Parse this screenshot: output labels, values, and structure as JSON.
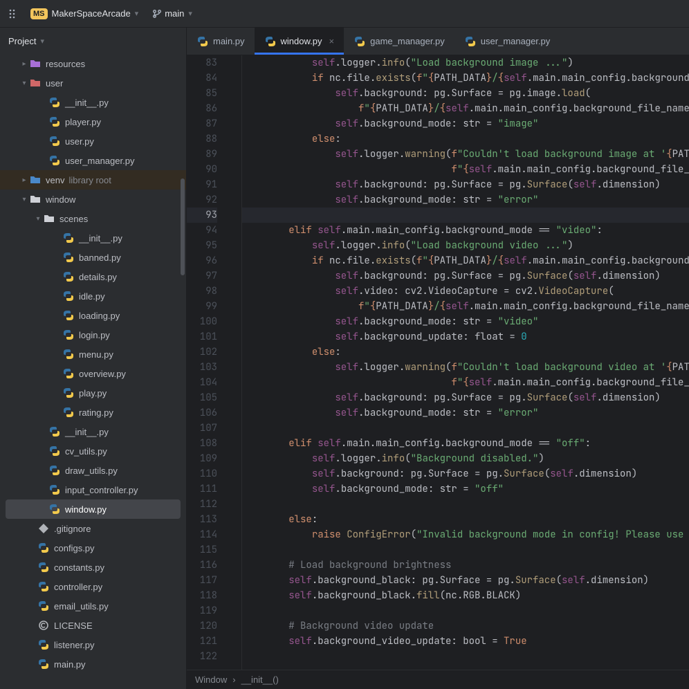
{
  "project": {
    "badge": "MS",
    "name": "MakerSpaceArcade",
    "branch": "main"
  },
  "sidebar": {
    "title": "Project",
    "items": [
      {
        "indent": 28,
        "arrow": "closed",
        "icon": "folder-purple",
        "label": "resources"
      },
      {
        "indent": 28,
        "arrow": "open",
        "icon": "folder-red",
        "label": "user"
      },
      {
        "indent": 56,
        "arrow": "",
        "icon": "py",
        "label": "__init__.py"
      },
      {
        "indent": 56,
        "arrow": "",
        "icon": "py",
        "label": "player.py"
      },
      {
        "indent": 56,
        "arrow": "",
        "icon": "py",
        "label": "user.py"
      },
      {
        "indent": 56,
        "arrow": "",
        "icon": "py",
        "label": "user_manager.py"
      },
      {
        "indent": 28,
        "arrow": "closed",
        "icon": "folder-lib",
        "label": "venv",
        "trailing": "library root",
        "variant": "venv"
      },
      {
        "indent": 28,
        "arrow": "open",
        "icon": "folder",
        "label": "window"
      },
      {
        "indent": 48,
        "arrow": "open",
        "icon": "folder",
        "label": "scenes"
      },
      {
        "indent": 76,
        "arrow": "",
        "icon": "py",
        "label": "__init__.py"
      },
      {
        "indent": 76,
        "arrow": "",
        "icon": "py",
        "label": "banned.py"
      },
      {
        "indent": 76,
        "arrow": "",
        "icon": "py",
        "label": "details.py"
      },
      {
        "indent": 76,
        "arrow": "",
        "icon": "py",
        "label": "idle.py"
      },
      {
        "indent": 76,
        "arrow": "",
        "icon": "py",
        "label": "loading.py"
      },
      {
        "indent": 76,
        "arrow": "",
        "icon": "py",
        "label": "login.py"
      },
      {
        "indent": 76,
        "arrow": "",
        "icon": "py",
        "label": "menu.py"
      },
      {
        "indent": 76,
        "arrow": "",
        "icon": "py",
        "label": "overview.py"
      },
      {
        "indent": 76,
        "arrow": "",
        "icon": "py",
        "label": "play.py"
      },
      {
        "indent": 76,
        "arrow": "",
        "icon": "py",
        "label": "rating.py"
      },
      {
        "indent": 56,
        "arrow": "",
        "icon": "py",
        "label": "__init__.py"
      },
      {
        "indent": 56,
        "arrow": "",
        "icon": "py",
        "label": "cv_utils.py"
      },
      {
        "indent": 56,
        "arrow": "",
        "icon": "py",
        "label": "draw_utils.py"
      },
      {
        "indent": 56,
        "arrow": "",
        "icon": "py",
        "label": "input_controller.py"
      },
      {
        "indent": 56,
        "arrow": "",
        "icon": "py",
        "label": "window.py",
        "selected": true
      },
      {
        "indent": 40,
        "arrow": "",
        "icon": "gitignore",
        "label": ".gitignore"
      },
      {
        "indent": 40,
        "arrow": "",
        "icon": "py",
        "label": "configs.py"
      },
      {
        "indent": 40,
        "arrow": "",
        "icon": "py",
        "label": "constants.py"
      },
      {
        "indent": 40,
        "arrow": "",
        "icon": "py",
        "label": "controller.py"
      },
      {
        "indent": 40,
        "arrow": "",
        "icon": "py",
        "label": "email_utils.py"
      },
      {
        "indent": 40,
        "arrow": "",
        "icon": "license",
        "label": "LICENSE"
      },
      {
        "indent": 40,
        "arrow": "",
        "icon": "py",
        "label": "listener.py"
      },
      {
        "indent": 40,
        "arrow": "",
        "icon": "py",
        "label": "main.py"
      }
    ]
  },
  "tabs": [
    {
      "label": "main.py",
      "active": false
    },
    {
      "label": "window.py",
      "active": true
    },
    {
      "label": "game_manager.py",
      "active": false
    },
    {
      "label": "user_manager.py",
      "active": false
    }
  ],
  "gutter": {
    "start": 83,
    "end": 122,
    "current": 93
  },
  "code_lines": [
    "            <span class='slf'>self</span>.logger.<span class='fn'>info</span>(<span class='str'>\"Load background image ...\"</span>)",
    "            <span class='kw'>if </span>nc.file.<span class='fn'>exists</span>(<span class='kw'>f</span><span class='str'>\"</span><span class='fstrbrace'>{</span>PATH_DATA<span class='fstrbrace'>}</span><span class='str'>/</span><span class='fstrbrace'>{</span><span class='slf'>self</span>.main.main_config.background_fil",
    "                <span class='slf'>self</span>.background: pg.Surface = pg.image.<span class='fn'>load</span>(",
    "                    <span class='kw'>f</span><span class='str'>\"</span><span class='fstrbrace'>{</span>PATH_DATA<span class='fstrbrace'>}</span><span class='str'>/</span><span class='fstrbrace'>{</span><span class='slf'>self</span>.main.main_config.background_file_name<span class='fstrbrace'>}</span><span class='str'>\"</span>)",
    "                <span class='slf'>self</span>.background_mode: <span class='typ'>str</span> = <span class='str'>\"image\"</span>",
    "            <span class='kw'>else</span>:",
    "                <span class='slf'>self</span>.logger.<span class='fn'>warning</span>(<span class='kw'>f</span><span class='str'>\"Couldn't load background image at '</span><span class='fstrbrace'>{</span>PATH_DA",
    "                                    <span class='kw'>f</span><span class='str'>\"</span><span class='fstrbrace'>{</span><span class='slf'>self</span>.main.main_config.background_file_name",
    "                <span class='slf'>self</span>.background: pg.Surface = pg.<span class='fn'>Surface</span>(<span class='slf'>self</span>.dimension)",
    "                <span class='slf'>self</span>.background_mode: <span class='typ'>str</span> = <span class='str'>\"error\"</span>",
    "",
    "        <span class='kw'>elif </span><span class='slf'>self</span>.main.main_config.background_mode == <span class='str'>\"video\"</span>:",
    "            <span class='slf'>self</span>.logger.<span class='fn'>info</span>(<span class='str'>\"Load background video ...\"</span>)",
    "            <span class='kw'>if </span>nc.file.<span class='fn'>exists</span>(<span class='kw'>f</span><span class='str'>\"</span><span class='fstrbrace'>{</span>PATH_DATA<span class='fstrbrace'>}</span><span class='str'>/</span><span class='fstrbrace'>{</span><span class='slf'>self</span>.main.main_config.background_fil",
    "                <span class='slf'>self</span>.background: pg.Surface = pg.<span class='fn'>Surface</span>(<span class='slf'>self</span>.dimension)",
    "                <span class='slf'>self</span>.video: cv2.VideoCapture = cv2.<span class='fn'>VideoCapture</span>(",
    "                    <span class='kw'>f</span><span class='str'>\"</span><span class='fstrbrace'>{</span>PATH_DATA<span class='fstrbrace'>}</span><span class='str'>/</span><span class='fstrbrace'>{</span><span class='slf'>self</span>.main.main_config.background_file_name<span class='fstrbrace'>}</span><span class='str'>\"</span>)",
    "                <span class='slf'>self</span>.background_mode: <span class='typ'>str</span> = <span class='str'>\"video\"</span>",
    "                <span class='slf'>self</span>.background_update: <span class='typ'>float</span> = <span class='num'>0</span>",
    "            <span class='kw'>else</span>:",
    "                <span class='slf'>self</span>.logger.<span class='fn'>warning</span>(<span class='kw'>f</span><span class='str'>\"Couldn't load background video at '</span><span class='fstrbrace'>{</span>PATH_DA",
    "                                    <span class='kw'>f</span><span class='str'>\"</span><span class='fstrbrace'>{</span><span class='slf'>self</span>.main.main_config.background_file_name",
    "                <span class='slf'>self</span>.background: pg.Surface = pg.<span class='fn'>Surface</span>(<span class='slf'>self</span>.dimension)",
    "                <span class='slf'>self</span>.background_mode: <span class='typ'>str</span> = <span class='str'>\"error\"</span>",
    "",
    "        <span class='kw'>elif </span><span class='slf'>self</span>.main.main_config.background_mode == <span class='str'>\"off\"</span>:",
    "            <span class='slf'>self</span>.logger.<span class='fn'>info</span>(<span class='str'>\"Background disabled.\"</span>)",
    "            <span class='slf'>self</span>.background: pg.Surface = pg.<span class='fn'>Surface</span>(<span class='slf'>self</span>.dimension)",
    "            <span class='slf'>self</span>.background_mode: <span class='typ'>str</span> = <span class='str'>\"off\"</span>",
    "",
    "        <span class='kw'>else</span>:",
    "            <span class='kw'>raise </span><span class='fn'>ConfigError</span>(<span class='str'>\"Invalid background mode in config! Please use 'ima</span>",
    "",
    "        <span class='cmt'># Load background brightness</span>",
    "        <span class='slf'>self</span>.background_black: pg.Surface = pg.<span class='fn'>Surface</span>(<span class='slf'>self</span>.dimension)",
    "        <span class='slf'>self</span>.background_black.<span class='fn'>fill</span>(nc.RGB.BLACK)",
    "",
    "        <span class='cmt'># Background video update</span>",
    "        <span class='slf'>self</span>.background_video_update: <span class='typ'>bool</span> = <span class='kw'>True</span>",
    ""
  ],
  "breadcrumb": {
    "a": "Window",
    "b": "__init__()",
    "sep": "›"
  }
}
